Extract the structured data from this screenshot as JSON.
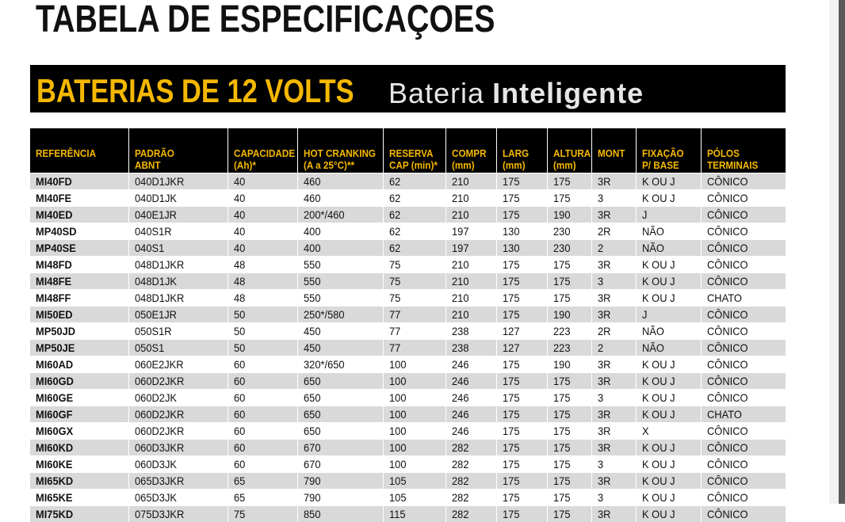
{
  "page_title": "TABELA DE ESPECIFICAÇOES",
  "banner": {
    "title": "BATERIAS DE 12 VOLTS",
    "brand_light": "Bateria",
    "brand_bold": "Inteligente"
  },
  "colors": {
    "accent": "#f5b800",
    "header_bg": "#000000",
    "row_alt": "#d9d9d9"
  },
  "table": {
    "headers": [
      {
        "l1": "REFERÊNCIA",
        "l2": ""
      },
      {
        "l1": "PADRÃO",
        "l2": "ABNT"
      },
      {
        "l1": "CAPACIDADE",
        "l2": "(Ah)*"
      },
      {
        "l1": "HOT CRANKING",
        "l2": "(A a 25°C)**"
      },
      {
        "l1": "RESERVA",
        "l2": "CAP (min)*"
      },
      {
        "l1": "COMPR",
        "l2": "(mm)"
      },
      {
        "l1": "LARG",
        "l2": "(mm)"
      },
      {
        "l1": "ALTURA",
        "l2": "(mm)"
      },
      {
        "l1": "MONT",
        "l2": ""
      },
      {
        "l1": "FIXAÇÃO",
        "l2": "P/ BASE"
      },
      {
        "l1": "PÓLOS",
        "l2": "TERMINAIS"
      }
    ],
    "rows": [
      [
        "MI40FD",
        "040D1JKR",
        "40",
        "460",
        "62",
        "210",
        "175",
        "175",
        "3R",
        "K OU J",
        "CÔNICO"
      ],
      [
        "MI40FE",
        "040D1JK",
        "40",
        "460",
        "62",
        "210",
        "175",
        "175",
        "3",
        "K OU J",
        "CÔNICO"
      ],
      [
        "MI40ED",
        "040E1JR",
        "40",
        "200*/460",
        "62",
        "210",
        "175",
        "190",
        "3R",
        "J",
        "CÔNICO"
      ],
      [
        "MP40SD",
        "040S1R",
        "40",
        "400",
        "62",
        "197",
        "130",
        "230",
        "2R",
        "NÃO",
        "CÔNICO"
      ],
      [
        "MP40SE",
        "040S1",
        "40",
        "400",
        "62",
        "197",
        "130",
        "230",
        "2",
        "NÃO",
        "CÔNICO"
      ],
      [
        "MI48FD",
        "048D1JKR",
        "48",
        "550",
        "75",
        "210",
        "175",
        "175",
        "3R",
        "K OU J",
        "CÔNICO"
      ],
      [
        "MI48FE",
        "048D1JK",
        "48",
        "550",
        "75",
        "210",
        "175",
        "175",
        "3",
        "K OU J",
        "CÔNICO"
      ],
      [
        "MI48FF",
        "048D1JKR",
        "48",
        "550",
        "75",
        "210",
        "175",
        "175",
        "3R",
        "K OU J",
        "CHATO"
      ],
      [
        "MI50ED",
        "050E1JR",
        "50",
        "250*/580",
        "77",
        "210",
        "175",
        "190",
        "3R",
        "J",
        "CÔNICO"
      ],
      [
        "MP50JD",
        "050S1R",
        "50",
        "450",
        "77",
        "238",
        "127",
        "223",
        "2R",
        "NÃO",
        "CÔNICO"
      ],
      [
        "MP50JE",
        "050S1",
        "50",
        "450",
        "77",
        "238",
        "127",
        "223",
        "2",
        "NÃO",
        "CÔNICO"
      ],
      [
        "MI60AD",
        "060E2JKR",
        "60",
        "320*/650",
        "100",
        "246",
        "175",
        "190",
        "3R",
        "K OU J",
        "CÔNICO"
      ],
      [
        "MI60GD",
        "060D2JKR",
        "60",
        "650",
        "100",
        "246",
        "175",
        "175",
        "3R",
        "K OU J",
        "CÔNICO"
      ],
      [
        "MI60GE",
        "060D2JK",
        "60",
        "650",
        "100",
        "246",
        "175",
        "175",
        "3",
        "K OU J",
        "CÔNICO"
      ],
      [
        "MI60GF",
        "060D2JKR",
        "60",
        "650",
        "100",
        "246",
        "175",
        "175",
        "3R",
        "K OU J",
        "CHATO"
      ],
      [
        "MI60GX",
        "060D2JKR",
        "60",
        "650",
        "100",
        "246",
        "175",
        "175",
        "3R",
        "X",
        "CÔNICO"
      ],
      [
        "MI60KD",
        "060D3JKR",
        "60",
        "670",
        "100",
        "282",
        "175",
        "175",
        "3R",
        "K OU J",
        "CÔNICO"
      ],
      [
        "MI60KE",
        "060D3JK",
        "60",
        "670",
        "100",
        "282",
        "175",
        "175",
        "3",
        "K OU J",
        "CÔNICO"
      ],
      [
        "MI65KD",
        "065D3JKR",
        "65",
        "790",
        "105",
        "282",
        "175",
        "175",
        "3R",
        "K OU J",
        "CÔNICO"
      ],
      [
        "MI65KE",
        "065D3JK",
        "65",
        "790",
        "105",
        "282",
        "175",
        "175",
        "3",
        "K OU J",
        "CÔNICO"
      ],
      [
        "MI75KD",
        "075D3JKR",
        "75",
        "850",
        "115",
        "282",
        "175",
        "175",
        "3R",
        "K OU J",
        "CÔNICO"
      ]
    ]
  }
}
